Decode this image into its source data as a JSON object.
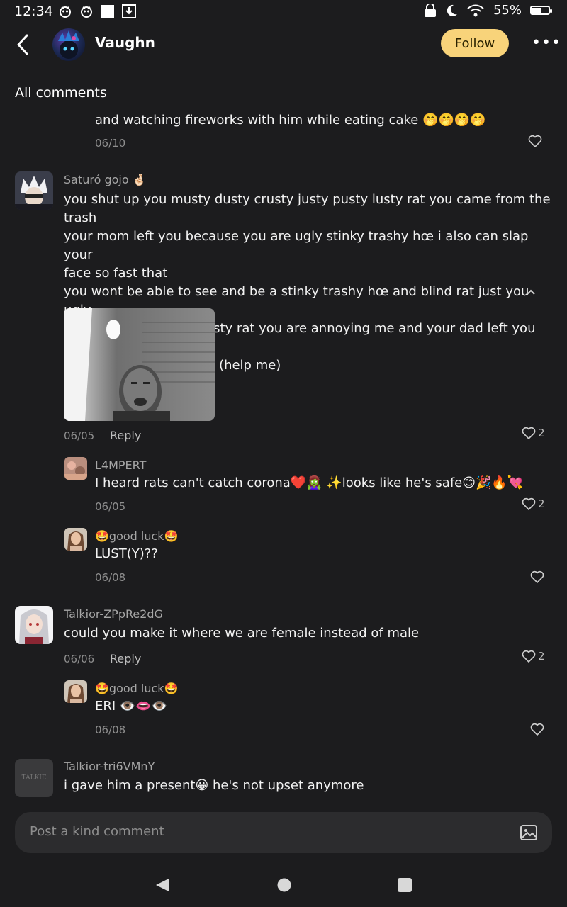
{
  "status": {
    "time": "12:34",
    "battery": "55%"
  },
  "header": {
    "name": "Vaughn",
    "follow_label": "Follow"
  },
  "section_title": "All comments",
  "comments": [
    {
      "text": "and watching fireworks with him while eating cake 🤭🤭🤭🤭",
      "date": "06/10"
    },
    {
      "user": "Saturó gojo 🤞🏻",
      "lines": [
        "you shut up you musty dusty crusty justy pusty lusty rat you came from the trash",
        "your mom left you because you are ugly stinky trashy hœ i also can slap your",
        "face so fast that",
        "you wont be able to see and be a stinky trashy hœ and blind rat just you ugly",
        "musty dusty crusty shusty rat you are annoying me and your dad left you for",
        "milk  and left no crumbs (help me)"
      ],
      "date": "06/05",
      "reply": "Reply",
      "likes": "2",
      "replies": [
        {
          "user": "L4MPERT",
          "text": "I heard rats can't catch corona❤️🧟‍♀️ ✨looks like he's safe😊🎉🔥💘",
          "date": "06/05",
          "likes": "2"
        },
        {
          "user": "🤩good luck🤩",
          "text": "LUST(Y)??",
          "date": "06/08"
        }
      ]
    },
    {
      "user": "Talkior-ZPpRe2dG",
      "text": "could you make it where we are female instead of male",
      "date": "06/06",
      "reply": "Reply",
      "likes": "2",
      "replies": [
        {
          "user": "🤩good luck🤩",
          "text": "ERI 👁️👄👁️",
          "date": "06/08"
        }
      ]
    },
    {
      "user": "Talkior-tri6VMnY",
      "text": "i gave him a present😀 he's not upset anymore",
      "avatar_text": "TALKIE"
    }
  ],
  "input": {
    "placeholder": "Post a kind comment"
  },
  "icons": [
    "back-icon",
    "more-icon",
    "heart-icon",
    "chevron-up-icon",
    "image-icon",
    "nav-back-icon",
    "nav-home-icon",
    "nav-recents-icon"
  ]
}
